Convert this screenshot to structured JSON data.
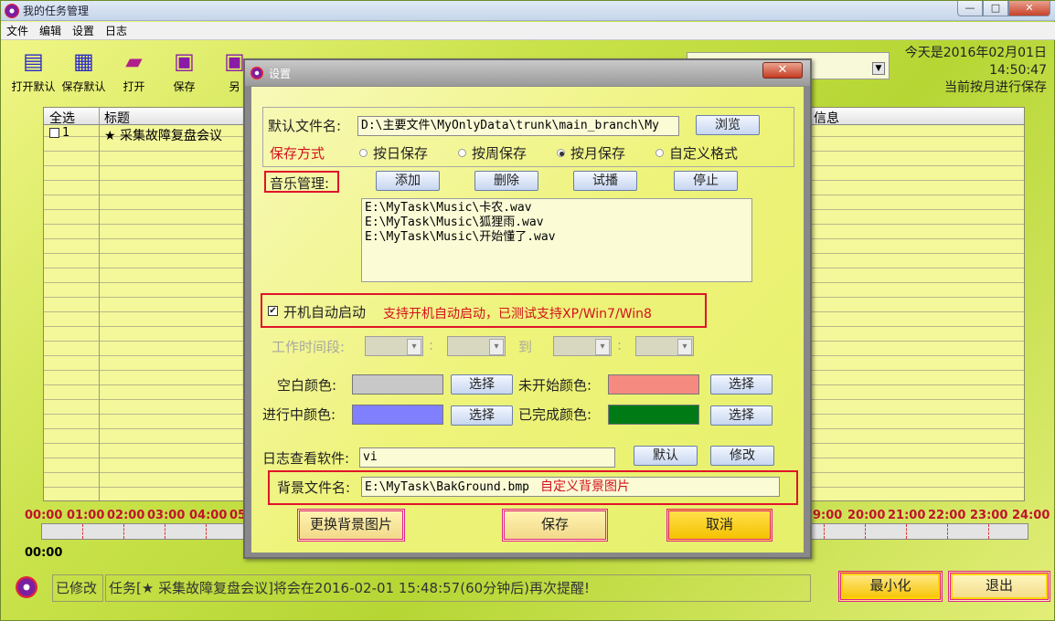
{
  "window": {
    "title": "我的任务管理",
    "minimize_glyph": "—",
    "maximize_glyph": "□",
    "close_glyph": "✕"
  },
  "menu": [
    "文件",
    "编辑",
    "设置",
    "日志"
  ],
  "toolbar": [
    {
      "label": "打开默认",
      "icon": "open-default-icon"
    },
    {
      "label": "保存默认",
      "icon": "save-default-icon"
    },
    {
      "label": "打开",
      "icon": "folder-open-icon"
    },
    {
      "label": "保存",
      "icon": "floppy-icon"
    },
    {
      "label": "另",
      "icon": "save-as-icon"
    }
  ],
  "header_info": {
    "date_line": "今天是2016年02月01日",
    "time_line": "14:50:47",
    "mode_line": "当前按月进行保存"
  },
  "grid": {
    "col_select": "全选",
    "col_title": "标题",
    "col_info": "信息",
    "row1_index": "1",
    "row1_title": "★ 采集故障复盘会议"
  },
  "timeline": {
    "labels": [
      "00:00",
      "01:00",
      "02:00",
      "03:00",
      "04:00",
      "05",
      "9:00",
      "20:00",
      "21:00",
      "22:00",
      "23:00",
      "24:00"
    ],
    "current": "00:00"
  },
  "status": {
    "modified": "已修改",
    "message": "任务[★ 采集故障复盘会议]将会在2016-02-01 15:48:57(60分钟后)再次提醒!"
  },
  "main_buttons": {
    "minimize": "最小化",
    "exit": "退出"
  },
  "dialog": {
    "title": "设置",
    "close_glyph": "✕",
    "default_file_label": "默认文件名:",
    "default_file_value": "D:\\主要文件\\MyOnlyData\\trunk\\main_branch\\My",
    "browse": "浏览",
    "save_mode_label": "保存方式",
    "save_modes": [
      "按日保存",
      "按周保存",
      "按月保存",
      "自定义格式"
    ],
    "save_mode_selected": "按月保存",
    "music_label": "音乐管理:",
    "music_buttons": [
      "添加",
      "删除",
      "试播",
      "停止"
    ],
    "music_files": [
      "E:\\MyTask\\Music\\卡农.wav",
      "E:\\MyTask\\Music\\狐狸雨.wav",
      "E:\\MyTask\\Music\\开始懂了.wav"
    ],
    "autostart_label": "开机自动启动",
    "autostart_checked": true,
    "autostart_note": "支持开机自动启动，已测试支持XP/Win7/Win8",
    "work_time_label": "工作时间段:",
    "sep_colon": ":",
    "to_label": "到",
    "blank_color_label": "空白颜色:",
    "notstarted_color_label": "未开始颜色:",
    "inprogress_color_label": "进行中颜色:",
    "done_color_label": "已完成颜色:",
    "choose": "选择",
    "colors": {
      "blank": "#c8c8c8",
      "notstarted": "#f58a80",
      "inprogress": "#8080ff",
      "done": "#007a14"
    },
    "log_viewer_label": "日志查看软件:",
    "log_viewer_value": "vi",
    "default_btn": "默认",
    "modify_btn": "修改",
    "bg_file_label": "背景文件名:",
    "bg_file_value": "E:\\MyTask\\BakGround.bmp",
    "bg_note": "自定义背景图片",
    "change_bg": "更换背景图片",
    "save": "保存",
    "cancel": "取消"
  }
}
